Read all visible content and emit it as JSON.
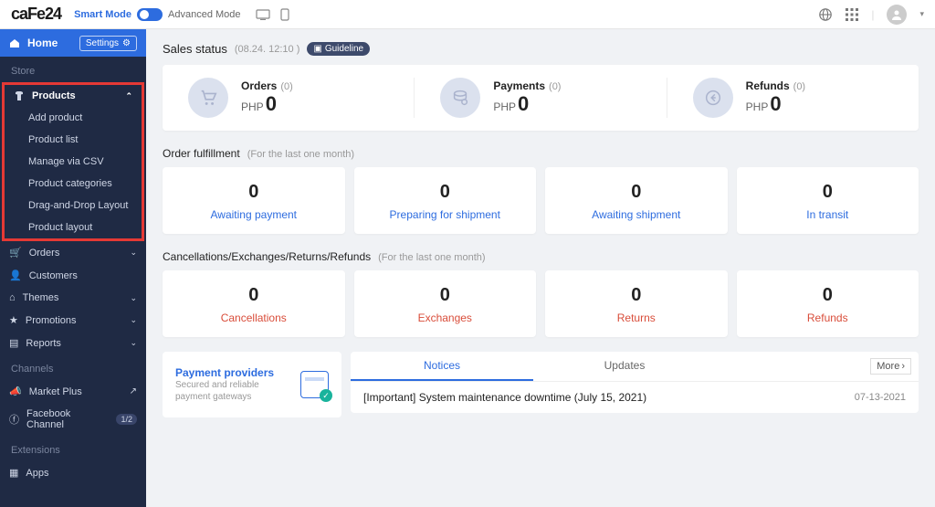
{
  "topbar": {
    "logo": "caFe24",
    "smart": "Smart Mode",
    "advanced": "Advanced Mode"
  },
  "sidebar": {
    "home": "Home",
    "settings": "Settings",
    "section_store": "Store",
    "products": {
      "label": "Products",
      "items": [
        "Add product",
        "Product list",
        "Manage via CSV",
        "Product categories",
        "Drag-and-Drop Layout",
        "Product layout"
      ]
    },
    "orders": "Orders",
    "customers": "Customers",
    "themes": "Themes",
    "promotions": "Promotions",
    "reports": "Reports",
    "section_channels": "Channels",
    "marketplus": "Market Plus",
    "facebook": "Facebook Channel",
    "fb_badge": "1/2",
    "section_ext": "Extensions",
    "apps": "Apps"
  },
  "sales": {
    "title": "Sales status",
    "timestamp": "(08.24. 12:10 )",
    "guideline": "Guideline",
    "cards": [
      {
        "label": "Orders",
        "count": "(0)",
        "currency": "PHP",
        "amount": "0"
      },
      {
        "label": "Payments",
        "count": "(0)",
        "currency": "PHP",
        "amount": "0"
      },
      {
        "label": "Refunds",
        "count": "(0)",
        "currency": "PHP",
        "amount": "0"
      }
    ]
  },
  "fulfill": {
    "title": "Order fulfillment",
    "sub": "(For the last one month)",
    "tiles": [
      {
        "num": "0",
        "label": "Awaiting payment"
      },
      {
        "num": "0",
        "label": "Preparing for shipment"
      },
      {
        "num": "0",
        "label": "Awaiting shipment"
      },
      {
        "num": "0",
        "label": "In transit"
      }
    ]
  },
  "refunds": {
    "title": "Cancellations/Exchanges/Returns/Refunds",
    "sub": "(For the last one month)",
    "tiles": [
      {
        "num": "0",
        "label": "Cancellations"
      },
      {
        "num": "0",
        "label": "Exchanges"
      },
      {
        "num": "0",
        "label": "Returns"
      },
      {
        "num": "0",
        "label": "Refunds"
      }
    ]
  },
  "payprov": {
    "title": "Payment providers",
    "sub": "Secured and reliable payment gateways"
  },
  "notices": {
    "tab_notices": "Notices",
    "tab_updates": "Updates",
    "more": "More",
    "row": {
      "title": "[Important] System maintenance downtime (July 15, 2021)",
      "date": "07-13-2021"
    }
  }
}
